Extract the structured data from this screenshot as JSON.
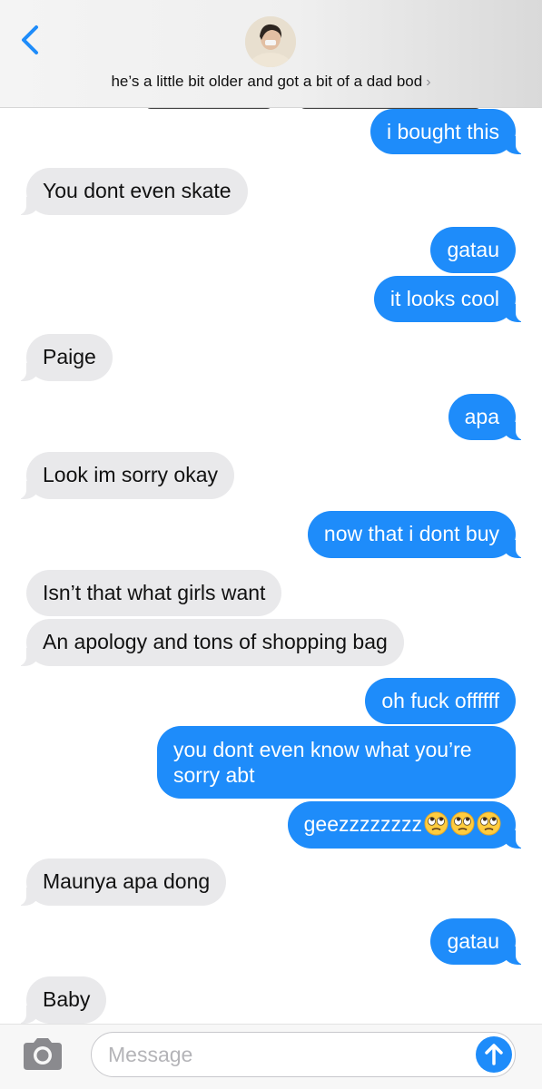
{
  "header": {
    "contact_name": "he’s a little bit older and got a bit of a dad bod",
    "chevron": "›",
    "back_icon": "chevron-left-icon",
    "accent_color": "#1e8cfa"
  },
  "messages": [
    {
      "side": "out",
      "text": "i bought this"
    },
    {
      "side": "in",
      "text": "You dont even skate"
    },
    {
      "side": "out",
      "text": "gatau"
    },
    {
      "side": "out",
      "text": "it looks cool"
    },
    {
      "side": "in",
      "text": "Paige"
    },
    {
      "side": "out",
      "text": "apa"
    },
    {
      "side": "in",
      "text": "Look im sorry okay"
    },
    {
      "side": "out",
      "text": "now that i dont buy"
    },
    {
      "side": "in",
      "text": "Isn’t that what girls want"
    },
    {
      "side": "in",
      "text": "An apology and tons of shopping bag"
    },
    {
      "side": "out",
      "text": "oh fuck offffff"
    },
    {
      "side": "out",
      "text": "you dont even know what you’re sorry abt"
    },
    {
      "side": "out",
      "text": "geezzzzzzzz",
      "emoji": [
        "face-with-rolling-eyes",
        "face-with-rolling-eyes",
        "face-with-rolling-eyes"
      ]
    },
    {
      "side": "in",
      "text": "Maunya apa dong"
    },
    {
      "side": "out",
      "text": "gatau"
    },
    {
      "side": "in",
      "text": "Baby"
    }
  ],
  "composer": {
    "placeholder": "Message",
    "camera_icon": "camera-icon",
    "send_icon": "arrow-up-icon"
  },
  "colors": {
    "outgoing_bubble": "#1e8cfa",
    "incoming_bubble": "#e9e9eb"
  }
}
